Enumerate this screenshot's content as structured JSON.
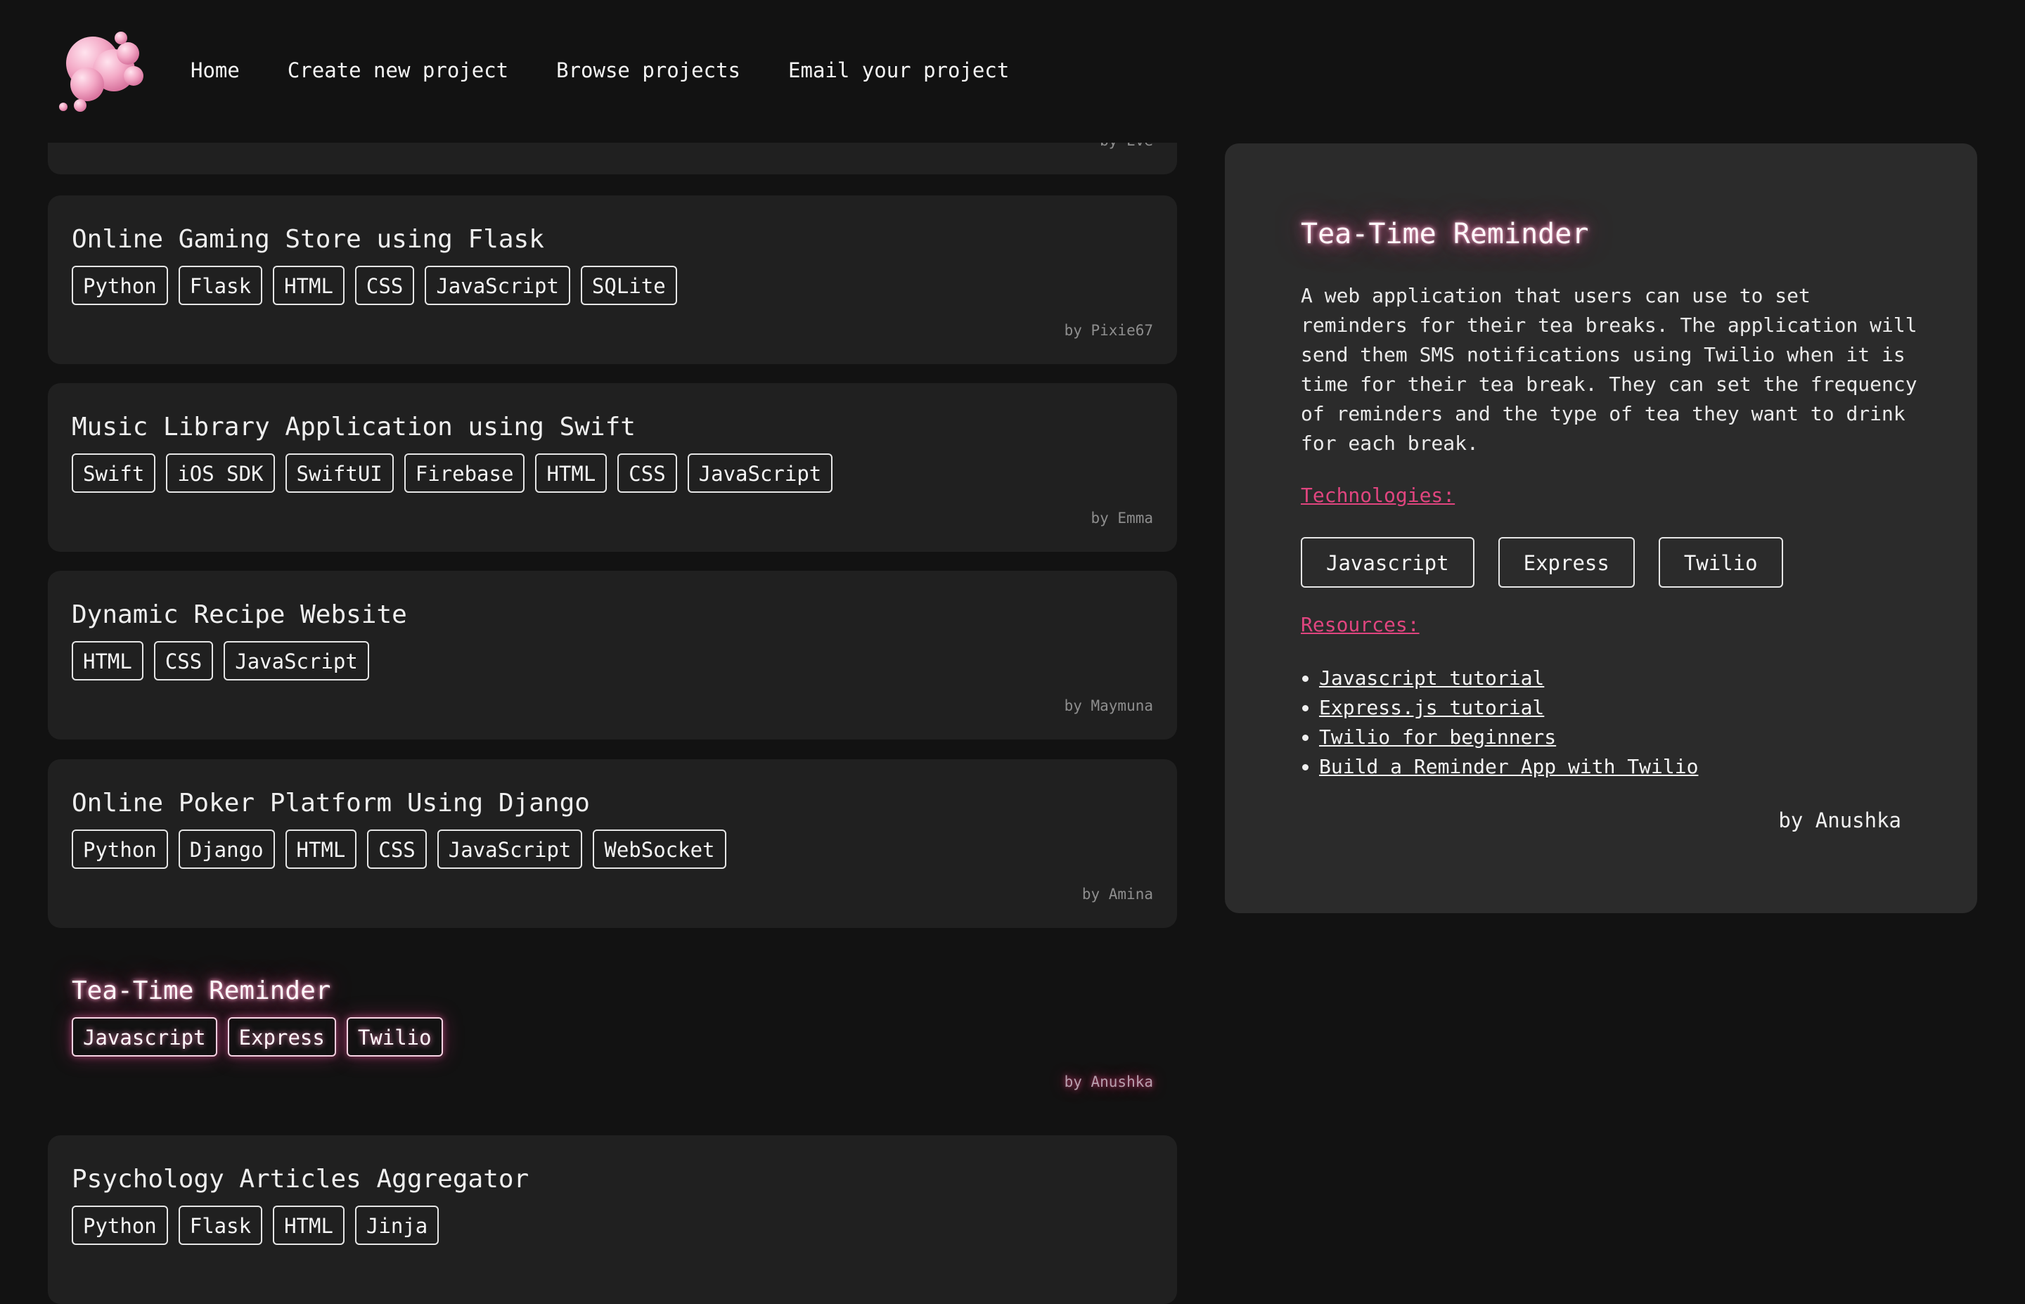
{
  "nav": {
    "items": [
      "Home",
      "Create new project",
      "Browse projects",
      "Email your project"
    ]
  },
  "projects": [
    {
      "title": "",
      "tags": [],
      "author": "by Eve"
    },
    {
      "title": "Online Gaming Store using Flask",
      "tags": [
        "Python",
        "Flask",
        "HTML",
        "CSS",
        "JavaScript",
        "SQLite"
      ],
      "author": "by Pixie67"
    },
    {
      "title": "Music Library Application using Swift",
      "tags": [
        "Swift",
        "iOS SDK",
        "SwiftUI",
        "Firebase",
        "HTML",
        "CSS",
        "JavaScript"
      ],
      "author": "by Emma"
    },
    {
      "title": "Dynamic Recipe Website",
      "tags": [
        "HTML",
        "CSS",
        "JavaScript"
      ],
      "author": "by Maymuna"
    },
    {
      "title": "Online Poker Platform Using Django",
      "tags": [
        "Python",
        "Django",
        "HTML",
        "CSS",
        "JavaScript",
        "WebSocket"
      ],
      "author": "by Amina"
    },
    {
      "title": "Tea-Time Reminder",
      "tags": [
        "Javascript",
        "Express",
        "Twilio"
      ],
      "author": "by Anushka",
      "selected": true
    },
    {
      "title": "Psychology Articles Aggregator",
      "tags": [
        "Python",
        "Flask",
        "HTML",
        "Jinja"
      ],
      "author": ""
    }
  ],
  "detail": {
    "title": "Tea-Time Reminder",
    "description": "A web application that users can use to set reminders for their tea breaks. The application will send them SMS notifications using Twilio when it is time for their tea break. They can set the frequency of reminders and the type of tea they want to drink for each break.",
    "technologies_label": "Technologies:",
    "technologies": [
      "Javascript",
      "Express",
      "Twilio"
    ],
    "resources_label": "Resources:",
    "resources": [
      "Javascript tutorial",
      "Express.js tutorial",
      "Twilio for beginners",
      "Build a Reminder App with Twilio"
    ],
    "author": "by Anushka"
  },
  "colors": {
    "background": "#121212",
    "card": "#202020",
    "panel": "#2b2b2b",
    "accent": "#e0457f",
    "glow": "#d75a93"
  }
}
